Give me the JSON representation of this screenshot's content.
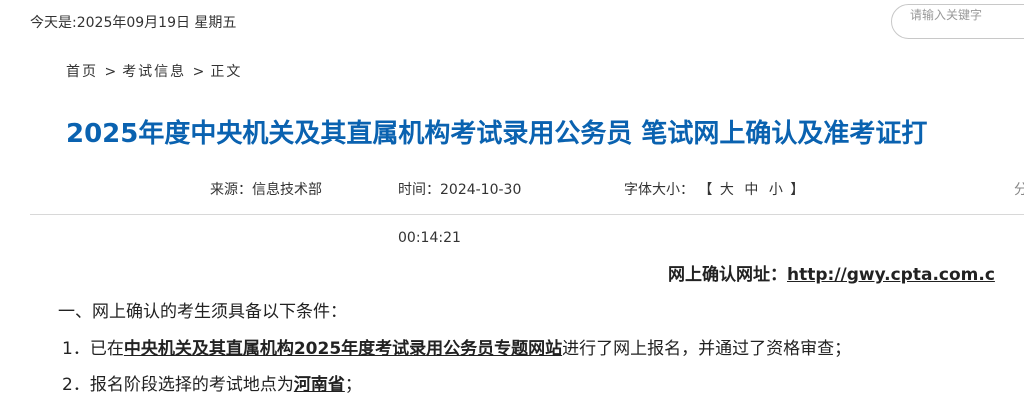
{
  "header": {
    "date_line": "今天是:2025年09月19日 星期五"
  },
  "search": {
    "placeholder": "请输入关键字"
  },
  "breadcrumb": {
    "home": "首页",
    "sep1": ">",
    "category": "考试信息",
    "sep2": ">",
    "current": "正文"
  },
  "article": {
    "title": "2025年度中央机关及其直属机构考试录用公务员 笔试网上确认及准考证打",
    "source": "来源：信息技术部",
    "time_label": "时间：2024-10-30",
    "time_extra": "00:14:21",
    "font_size_label": "字体大小：",
    "font_size_open": "【",
    "font_size_large": "大",
    "font_size_medium": "中",
    "font_size_small": "小",
    "font_size_close": "】",
    "share_partial": "分",
    "confirm_label": "网上确认网址：",
    "confirm_url": "http://gwy.cpta.com.c",
    "section_heading": "一、网上确认的考生须具备以下条件：",
    "item1_prefix": "1．已在",
    "item1_link": "中央机关及其直属机构2025年度考试录用公务员专题网站",
    "item1_suffix": "进行了网上报名，并通过了资格审查；",
    "item2_prefix": "2．报名阶段选择的考试地点为",
    "item2_link": "河南省",
    "item2_suffix": "；"
  },
  "colors": {
    "title": "#0a62b0",
    "text": "#333333"
  }
}
